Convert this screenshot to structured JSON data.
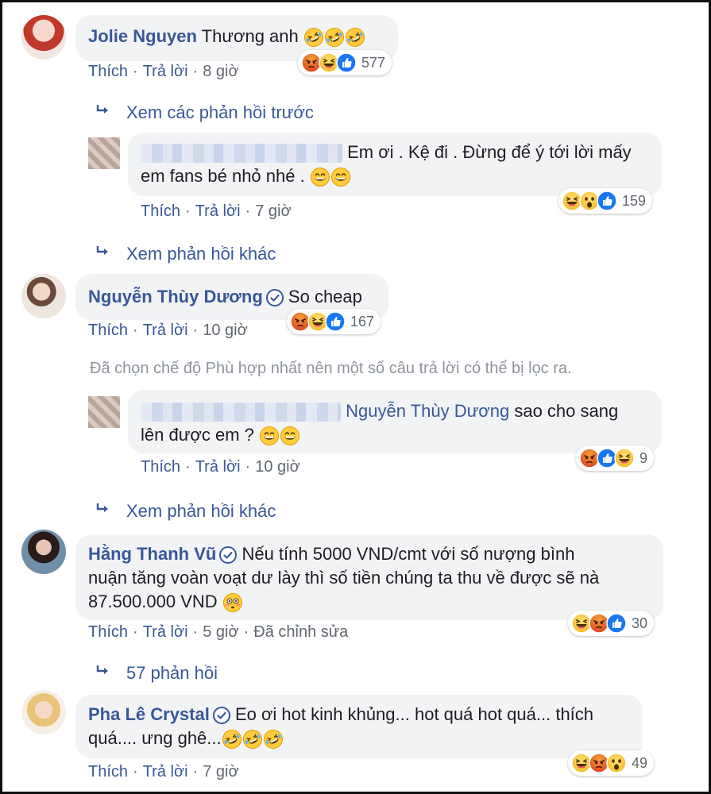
{
  "comments": [
    {
      "name": "Jolie Nguyen",
      "text": "Thương anh",
      "text_emojis": [
        "rofl",
        "rofl",
        "rofl"
      ],
      "actions": {
        "like": "Thích",
        "reply": "Trả lời",
        "time": "8 giờ"
      },
      "reactions": {
        "icons": [
          "angry",
          "laugh",
          "like"
        ],
        "count": "577"
      }
    },
    {
      "name": "Nguyễn Thùy Dương",
      "verified": true,
      "text": "So cheap",
      "actions": {
        "like": "Thích",
        "reply": "Trả lời",
        "time": "10 giờ"
      },
      "reactions": {
        "icons": [
          "angry",
          "laugh",
          "like"
        ],
        "count": "167"
      }
    },
    {
      "name": "Hằng Thanh Vũ",
      "verified": true,
      "text_line1": "Nếu tính 5000 VND/cmt với số nượng bình",
      "text_line2": "nuận tăng voàn voạt dư lày thì số tiền chúng ta thu về được sẽ nà",
      "text_line3": "87.500.000 VND",
      "text_emojis": [
        "flushed"
      ],
      "actions": {
        "like": "Thích",
        "reply": "Trả lời",
        "time": "5 giờ",
        "edited": "Đã chỉnh sửa"
      },
      "reactions": {
        "icons": [
          "laugh",
          "angry",
          "like"
        ],
        "count": "30"
      }
    },
    {
      "name": "Pha Lê Crystal",
      "verified": true,
      "text_line1": "Eo ơi hot kinh khủng... hot quá hot quá... thích",
      "text_line2": "quá.... ưng ghê...",
      "text_emojis": [
        "rofl",
        "rofl",
        "rofl"
      ],
      "actions": {
        "like": "Thích",
        "reply": "Trả lời",
        "time": "7 giờ"
      },
      "reactions": {
        "icons": [
          "laugh",
          "angry",
          "wow"
        ],
        "count": "49"
      }
    }
  ],
  "replies": [
    {
      "text_line1": "Em ơi . Kệ đi . Đừng để ý tới lời mấy",
      "text_line2": "em fans bé nhỏ nhé .",
      "text_emojis": [
        "grin",
        "grin"
      ],
      "actions": {
        "like": "Thích",
        "reply": "Trả lời",
        "time": "7 giờ"
      },
      "reactions": {
        "icons": [
          "laugh",
          "wow",
          "like"
        ],
        "count": "159"
      }
    },
    {
      "mention": "Nguyễn Thùy Dương",
      "text_line1": "sao cho sang",
      "text_line2": "lên được em ?",
      "text_emojis": [
        "grin",
        "grin"
      ],
      "actions": {
        "like": "Thích",
        "reply": "Trả lời",
        "time": "10 giờ"
      },
      "reactions": {
        "icons": [
          "angry",
          "like",
          "laugh"
        ],
        "count": "9"
      }
    }
  ],
  "view_previous": "Xem các phản hồi trước",
  "view_more_1": "Xem phản hồi khác",
  "view_more_2": "Xem phản hồi khác",
  "replies_count": "57 phản hồi",
  "filter_notice": "Đã chọn chế độ Phù hợp nhất nên một số câu trả lời có thể bị lọc ra.",
  "colors": {
    "link": "#385898",
    "bubble": "#f2f3f5",
    "meta": "#606770",
    "notice": "#8d949e",
    "like": "#1877f2"
  },
  "icons": {
    "reply_arrow": "reply-arrow-icon",
    "verified": "verified-badge-icon"
  }
}
